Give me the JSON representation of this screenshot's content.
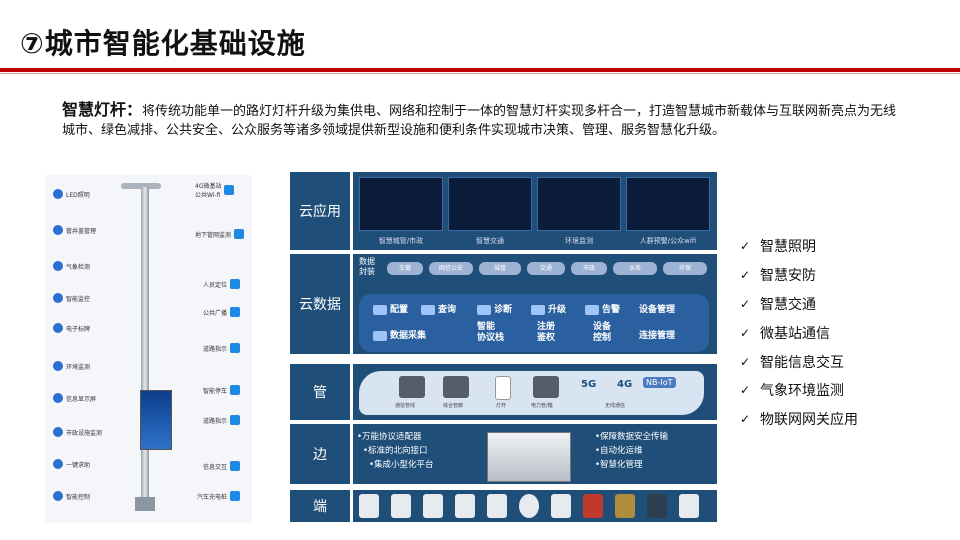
{
  "slide": {
    "title": "⑦城市智能化基础设施",
    "intro_lead": "智慧灯杆：",
    "intro_text": "将传统功能单一的路灯灯杆升级为集供电、网络和控制于一体的智慧灯杆实现多杆合一，打造智慧城市新载体与互联网新亮点为无线城市、绿色减排、公共安全、公众服务等诸多领域提供新型设施和便利条件实现城市决策、管理、服务智慧化升级。"
  },
  "pole": {
    "left_features": [
      "LED照明",
      "管井盖管理",
      "气象检测",
      "智能监控",
      "电子标牌",
      "环境监测",
      "信息显示屏",
      "市政设施监测",
      "一键求助",
      "智能控制"
    ],
    "right_features": [
      "4G微基站\n公共Wi-fi",
      "地下管网监测",
      "人员定位",
      "公共广播",
      "道路指示",
      "智能停车",
      "道路指示",
      "信息交互",
      "汽车充电桩"
    ]
  },
  "architecture": {
    "rows": {
      "cloud_app": "云应用",
      "cloud_data": "云数据",
      "pipe": "管",
      "edge": "边",
      "end": "端"
    },
    "cloud_app_tiles": [
      "智慧城管/市政",
      "智慧交通",
      "环境监测",
      "人群预警/公众wifi"
    ],
    "data_pack_label": "数据\n封装",
    "data_pack_pills": [
      "车载",
      "网信公安",
      "城管",
      "交通",
      "市政",
      "水务",
      "环保"
    ],
    "cloud_data_items": [
      "配置",
      "查询",
      "诊断",
      "升级",
      "告警",
      "设备管理",
      "数据采集",
      "智能\n协议栈",
      "注册\n鉴权",
      "设备\n控制",
      "连接管理"
    ],
    "pipe_items": [
      "通信管线",
      "综合管廊",
      "灯杆",
      "电力管/箱",
      "5G",
      "4G",
      "NB-IoT",
      "无线通信"
    ],
    "edge_left": [
      "万能协议适配器",
      "标准的北向接口",
      "集成小型化平台"
    ],
    "edge_right": [
      "保障数据安全传输",
      "自动化运维",
      "智慧化管理"
    ]
  },
  "features_list": [
    "智慧照明",
    "智慧安防",
    "智慧交通",
    "微基站通信",
    "智能信息交互",
    "气象环境监测",
    "物联网网关应用"
  ],
  "check_glyph": "✓"
}
